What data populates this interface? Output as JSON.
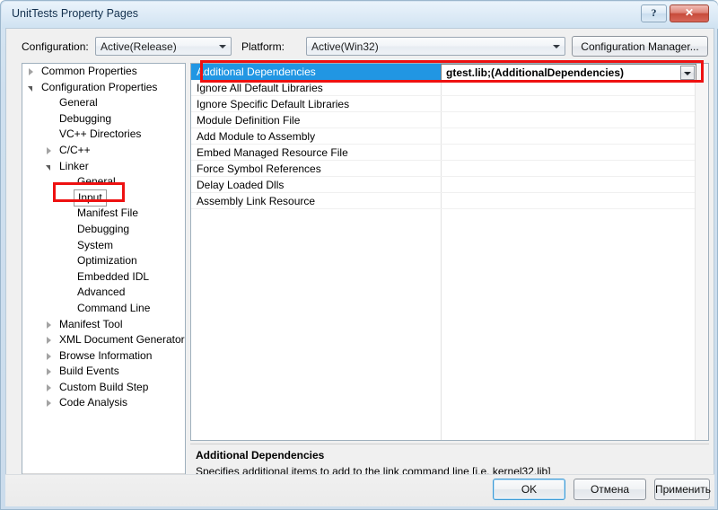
{
  "window": {
    "title": "UnitTests Property Pages",
    "help_button": "?",
    "close_button": "✕"
  },
  "toolbar": {
    "configuration_label": "Configuration:",
    "configuration_value": "Active(Release)",
    "platform_label": "Platform:",
    "platform_value": "Active(Win32)",
    "configuration_manager_label": "Configuration Manager..."
  },
  "tree": {
    "items": [
      {
        "label": "Common Properties",
        "indent": 0,
        "twisty": "collapsed"
      },
      {
        "label": "Configuration Properties",
        "indent": 0,
        "twisty": "expanded"
      },
      {
        "label": "General",
        "indent": 1,
        "twisty": "none"
      },
      {
        "label": "Debugging",
        "indent": 1,
        "twisty": "none"
      },
      {
        "label": "VC++ Directories",
        "indent": 1,
        "twisty": "none"
      },
      {
        "label": "C/C++",
        "indent": 1,
        "twisty": "collapsed"
      },
      {
        "label": "Linker",
        "indent": 1,
        "twisty": "expanded"
      },
      {
        "label": "General",
        "indent": 2,
        "twisty": "none"
      },
      {
        "label": "Input",
        "indent": 2,
        "twisty": "none",
        "selected": true
      },
      {
        "label": "Manifest File",
        "indent": 2,
        "twisty": "none"
      },
      {
        "label": "Debugging",
        "indent": 2,
        "twisty": "none"
      },
      {
        "label": "System",
        "indent": 2,
        "twisty": "none"
      },
      {
        "label": "Optimization",
        "indent": 2,
        "twisty": "none"
      },
      {
        "label": "Embedded IDL",
        "indent": 2,
        "twisty": "none"
      },
      {
        "label": "Advanced",
        "indent": 2,
        "twisty": "none"
      },
      {
        "label": "Command Line",
        "indent": 2,
        "twisty": "none"
      },
      {
        "label": "Manifest Tool",
        "indent": 1,
        "twisty": "collapsed"
      },
      {
        "label": "XML Document Generator",
        "indent": 1,
        "twisty": "collapsed"
      },
      {
        "label": "Browse Information",
        "indent": 1,
        "twisty": "collapsed"
      },
      {
        "label": "Build Events",
        "indent": 1,
        "twisty": "collapsed"
      },
      {
        "label": "Custom Build Step",
        "indent": 1,
        "twisty": "collapsed"
      },
      {
        "label": "Code Analysis",
        "indent": 1,
        "twisty": "collapsed"
      }
    ]
  },
  "grid": {
    "rows": [
      {
        "name": "Additional Dependencies",
        "value": "gtest.lib;(AdditionalDependencies)",
        "selected": true
      },
      {
        "name": "Ignore All Default Libraries",
        "value": ""
      },
      {
        "name": "Ignore Specific Default Libraries",
        "value": ""
      },
      {
        "name": "Module Definition File",
        "value": ""
      },
      {
        "name": "Add Module to Assembly",
        "value": ""
      },
      {
        "name": "Embed Managed Resource File",
        "value": ""
      },
      {
        "name": "Force Symbol References",
        "value": ""
      },
      {
        "name": "Delay Loaded Dlls",
        "value": ""
      },
      {
        "name": "Assembly Link Resource",
        "value": ""
      }
    ],
    "editor_value": "gtest.lib;(AdditionalDependencies)"
  },
  "description": {
    "title": "Additional Dependencies",
    "text": "Specifies additional items to add to the link command line [i.e. kernel32.lib]"
  },
  "footer": {
    "ok_label": "OK",
    "cancel_label": "Отмена",
    "apply_label": "Применить"
  },
  "colors": {
    "selection_blue": "#2196e3",
    "annotation_red": "#ee1111",
    "close_red": "#c74b3a",
    "focus_blue": "#3c9ad6"
  }
}
